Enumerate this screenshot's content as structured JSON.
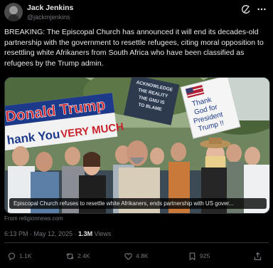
{
  "author": {
    "name": "Jack Jenkins",
    "handle": "@jackmjenkins"
  },
  "post": {
    "text": "BREAKING: The Episcopal Church has announced it will end its decades-old partnership with the government to resettle refugees, citing moral opposition to resettling white Afrikaners from South Africa who have been classified as refugees by the Trump admin.",
    "media": {
      "caption": "Episcopal Church refuses to resettle white Afrikaners, ends partnership with US gover...",
      "signs": {
        "banner_line1": "Donald Trump",
        "banner_line2a": "hank You",
        "banner_line2b": "VERY MUCH",
        "center_sign": [
          "ACKNOWLEDGE",
          "THE REALITY",
          "THE GNU IS",
          "TO BLAME"
        ],
        "right_sign": [
          "Thank",
          "God for",
          "President",
          "Trump !!"
        ]
      }
    },
    "source": "From religionnews.com",
    "timestamp": "6:13 PM · May 12, 2025 · ",
    "views_count": "1.3M",
    "views_label": " Views"
  },
  "actions": {
    "replies": "1.1K",
    "reposts": "2.4K",
    "likes": "4.8K",
    "bookmarks": "925"
  },
  "icons": {
    "grok": "grok-icon",
    "more": "more-icon",
    "reply": "reply-icon",
    "repost": "repost-icon",
    "like": "heart-icon",
    "bookmark": "bookmark-icon",
    "share": "share-icon"
  },
  "colors": {
    "background": "#000000",
    "text": "#e7e9ea",
    "muted": "#71767b",
    "border": "#2f3336"
  }
}
